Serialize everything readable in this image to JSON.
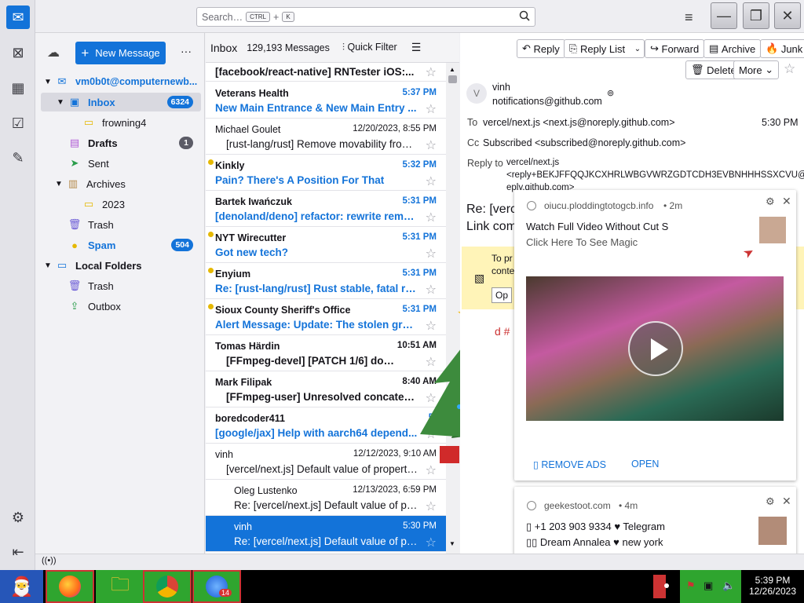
{
  "search": {
    "placeholder": "Search…",
    "key1": "CTRL",
    "plus": "+",
    "key2": "K"
  },
  "folders": {
    "new_message": "New Message",
    "account": "vm0b0t@computernewb...",
    "items": [
      {
        "label": "Inbox",
        "count": "6324"
      },
      {
        "label": "frowning4",
        "count": ""
      },
      {
        "label": "Drafts",
        "count": "1"
      },
      {
        "label": "Sent",
        "count": ""
      },
      {
        "label": "Archives",
        "count": ""
      },
      {
        "label": "2023",
        "count": ""
      },
      {
        "label": "Trash",
        "count": ""
      },
      {
        "label": "Spam",
        "count": "504"
      },
      {
        "label": "Local Folders",
        "count": ""
      },
      {
        "label": "Trash",
        "count": ""
      },
      {
        "label": "Outbox",
        "count": ""
      }
    ]
  },
  "list": {
    "folder": "Inbox",
    "count": "129,193 Messages",
    "quick_filter": "Quick Filter",
    "messages": [
      {
        "from": "",
        "date": "",
        "subject": "[facebook/react-native] RNTester iOS:..."
      },
      {
        "from": "Veterans Health",
        "date": "5:37 PM",
        "subject": "New Main Entrance & New Main Entry ..."
      },
      {
        "from": "Michael Goulet",
        "date": "12/20/2023, 8:55 PM",
        "subject": "[rust-lang/rust] Remove movability from..."
      },
      {
        "from": "Kinkly",
        "date": "5:32 PM",
        "subject": "Pain? There's A Position For That"
      },
      {
        "from": "Bartek Iwańczuk",
        "date": "5:31 PM",
        "subject": "[denoland/deno] refactor: rewrite rema..."
      },
      {
        "from": "NYT Wirecutter",
        "date": "5:31 PM",
        "subject": "Got new tech?"
      },
      {
        "from": "Enyium",
        "date": "5:31 PM",
        "subject": "Re: [rust-lang/rust] Rust stable, fatal ru..."
      },
      {
        "from": "Sioux County Sheriff's Office",
        "date": "5:31 PM",
        "subject": "Alert Message: Update: The stolen gree..."
      },
      {
        "from": "Tomas Härdin",
        "date": "10:51 AM",
        "subject": "[FFmpeg-devel] [PATCH 1/6] doc/..."
      },
      {
        "from": "Mark Filipak",
        "date": "8:40 AM",
        "subject": "[FFmpeg-user] Unresolved concatena..."
      },
      {
        "from": "boredcoder411",
        "date": "5:",
        "subject": "[google/jax] Help with aarch64 depend..."
      },
      {
        "from": "vinh",
        "date": "12/12/2023, 9:10 AM",
        "subject": "[vercel/next.js] Default value of property..."
      },
      {
        "from": "Oleg Lustenko",
        "date": "12/13/2023, 6:59 PM",
        "subject": "Re: [vercel/next.js] Default value of pro..."
      },
      {
        "from": "vinh",
        "date": "5:30 PM",
        "subject": "Re: [vercel/next.js] Default value of pro..."
      }
    ]
  },
  "toolbar": {
    "reply": "Reply",
    "reply_list": "Reply List",
    "forward": "Forward",
    "archive": "Archive",
    "junk": "Junk",
    "delete": "Delete",
    "more": "More"
  },
  "message": {
    "avatar": "V",
    "sender": "vinh",
    "sender_email": "notifications@github.com",
    "to_label": "To",
    "to": "vercel/next.js <next.js@noreply.github.com>",
    "time": "5:30 PM",
    "cc_label": "Cc",
    "cc": "Subscribed <subscribed@noreply.github.com>",
    "replyto_label": "Reply to",
    "replyto_1": "vercel/next.js",
    "replyto_2": "<reply+BEKJFFQQJKCXHRLWBGVWRZGDTCDH3EVBNHHHSSXCVU@r",
    "replyto_3": "eply.github.com>",
    "subject_frag": "Re: [verc",
    "link_frag": "Link com",
    "banner_1": "To pr",
    "banner_2": "conte",
    "banner_btn": "Op",
    "body_frag": "d #"
  },
  "ad1": {
    "source": "oiucu.ploddingtotogcb.info",
    "age": "• 2m",
    "title": "Watch Full Video Without Cut S",
    "subtitle": "Click Here To See Magic",
    "remove": "▯ REMOVE ADS",
    "open": "OPEN"
  },
  "ad2": {
    "source": "geekestoot.com",
    "age": "• 4m",
    "line1": "▯ +1 203 903 9334 ♥ Telegram",
    "line2": "▯▯ Dream Annalea ♥ new york"
  },
  "clock": {
    "time": "5:39 PM",
    "date": "12/26/2023"
  },
  "taskbar": {
    "badge": "14"
  },
  "colors": {
    "accent": "#1373d9",
    "unread_dot": "#e5b800",
    "taskbar": "#000000",
    "task_green": "#2fa52f"
  }
}
